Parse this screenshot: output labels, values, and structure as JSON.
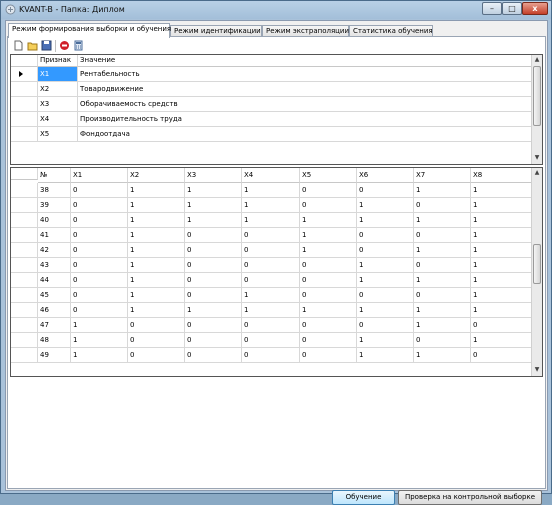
{
  "window": {
    "title": "KVANT-B - Папка: Диплом",
    "minimize_label": "–",
    "maximize_label": "□",
    "close_label": "x"
  },
  "tabs": [
    {
      "label": "Режим формирования выборки и обучения"
    },
    {
      "label": "Режим идентификации"
    },
    {
      "label": "Режим экстраполяции"
    },
    {
      "label": "Статистика обучения"
    }
  ],
  "toolbar": {
    "icons": [
      "new-file-icon",
      "open-folder-icon",
      "save-icon",
      "stop-icon",
      "calculator-icon"
    ]
  },
  "features_grid": {
    "headers": {
      "code": "Признак",
      "value": "Значение"
    },
    "rows": [
      {
        "code": "X1",
        "value": "Рентабельность"
      },
      {
        "code": "X2",
        "value": "Товародвижение"
      },
      {
        "code": "X3",
        "value": "Оборачиваемость средств"
      },
      {
        "code": "X4",
        "value": "Производительность труда"
      },
      {
        "code": "X5",
        "value": "Фондоотдача"
      }
    ]
  },
  "sample_grid": {
    "headers": [
      "№",
      "X1",
      "X2",
      "X3",
      "X4",
      "X5",
      "X6",
      "X7",
      "X8"
    ],
    "rows": [
      [
        "38",
        "0",
        "1",
        "1",
        "1",
        "0",
        "0",
        "1",
        "1"
      ],
      [
        "39",
        "0",
        "1",
        "1",
        "1",
        "0",
        "1",
        "0",
        "1"
      ],
      [
        "40",
        "0",
        "1",
        "1",
        "1",
        "1",
        "1",
        "1",
        "1"
      ],
      [
        "41",
        "0",
        "1",
        "0",
        "0",
        "1",
        "0",
        "0",
        "1"
      ],
      [
        "42",
        "0",
        "1",
        "0",
        "0",
        "1",
        "0",
        "1",
        "1"
      ],
      [
        "43",
        "0",
        "1",
        "0",
        "0",
        "0",
        "1",
        "0",
        "1"
      ],
      [
        "44",
        "0",
        "1",
        "0",
        "0",
        "0",
        "1",
        "1",
        "1"
      ],
      [
        "45",
        "0",
        "1",
        "0",
        "1",
        "0",
        "0",
        "0",
        "1"
      ],
      [
        "46",
        "0",
        "1",
        "1",
        "1",
        "1",
        "1",
        "1",
        "1"
      ],
      [
        "47",
        "1",
        "0",
        "0",
        "0",
        "0",
        "0",
        "1",
        "0"
      ],
      [
        "48",
        "1",
        "0",
        "0",
        "0",
        "0",
        "1",
        "0",
        "1"
      ],
      [
        "49",
        "1",
        "0",
        "0",
        "0",
        "0",
        "1",
        "1",
        "0"
      ]
    ]
  },
  "buttons": {
    "train": "Обучение",
    "check": "Проверка на контрольной выборке"
  },
  "colors": {
    "selection": "#3399ff",
    "close_button": "#c4402a"
  }
}
